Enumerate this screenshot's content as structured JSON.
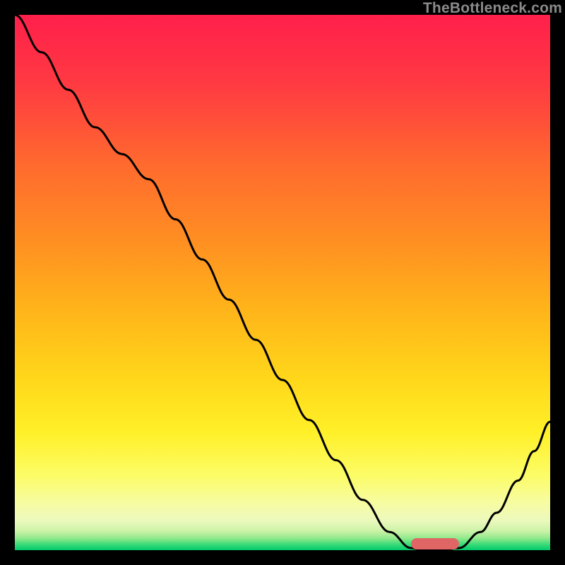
{
  "watermark": "TheBottleneck.com",
  "chart_data": {
    "type": "line",
    "title": "",
    "xlabel": "",
    "ylabel": "",
    "xlim": [
      0,
      1
    ],
    "ylim": [
      0,
      1
    ],
    "grid": false,
    "series": [
      {
        "name": "bottleneck-curve",
        "x": [
          0.0,
          0.05,
          0.1,
          0.15,
          0.2,
          0.25,
          0.3,
          0.35,
          0.4,
          0.45,
          0.5,
          0.55,
          0.6,
          0.65,
          0.7,
          0.74,
          0.76,
          0.8,
          0.83,
          0.87,
          0.9,
          0.94,
          0.97,
          1.0
        ],
        "y": [
          1.0,
          0.93,
          0.86,
          0.79,
          0.74,
          0.693,
          0.618,
          0.543,
          0.468,
          0.393,
          0.318,
          0.243,
          0.168,
          0.094,
          0.034,
          0.004,
          0.0,
          0.0,
          0.004,
          0.034,
          0.07,
          0.13,
          0.185,
          0.24
        ]
      }
    ],
    "marker": {
      "x_start": 0.74,
      "x_end": 0.83,
      "y": 0.012
    },
    "gradient_stops": [
      {
        "offset": 0.0,
        "color": "#ff1f4b"
      },
      {
        "offset": 0.13,
        "color": "#ff3a42"
      },
      {
        "offset": 0.28,
        "color": "#ff6a2e"
      },
      {
        "offset": 0.42,
        "color": "#ff8e22"
      },
      {
        "offset": 0.55,
        "color": "#ffb41a"
      },
      {
        "offset": 0.68,
        "color": "#ffd71a"
      },
      {
        "offset": 0.78,
        "color": "#fff028"
      },
      {
        "offset": 0.86,
        "color": "#fcfc66"
      },
      {
        "offset": 0.91,
        "color": "#f7fca0"
      },
      {
        "offset": 0.945,
        "color": "#ecf9bd"
      },
      {
        "offset": 0.965,
        "color": "#c9f2a6"
      },
      {
        "offset": 0.978,
        "color": "#8fe98b"
      },
      {
        "offset": 0.99,
        "color": "#35da77"
      },
      {
        "offset": 1.0,
        "color": "#00c86b"
      }
    ]
  }
}
